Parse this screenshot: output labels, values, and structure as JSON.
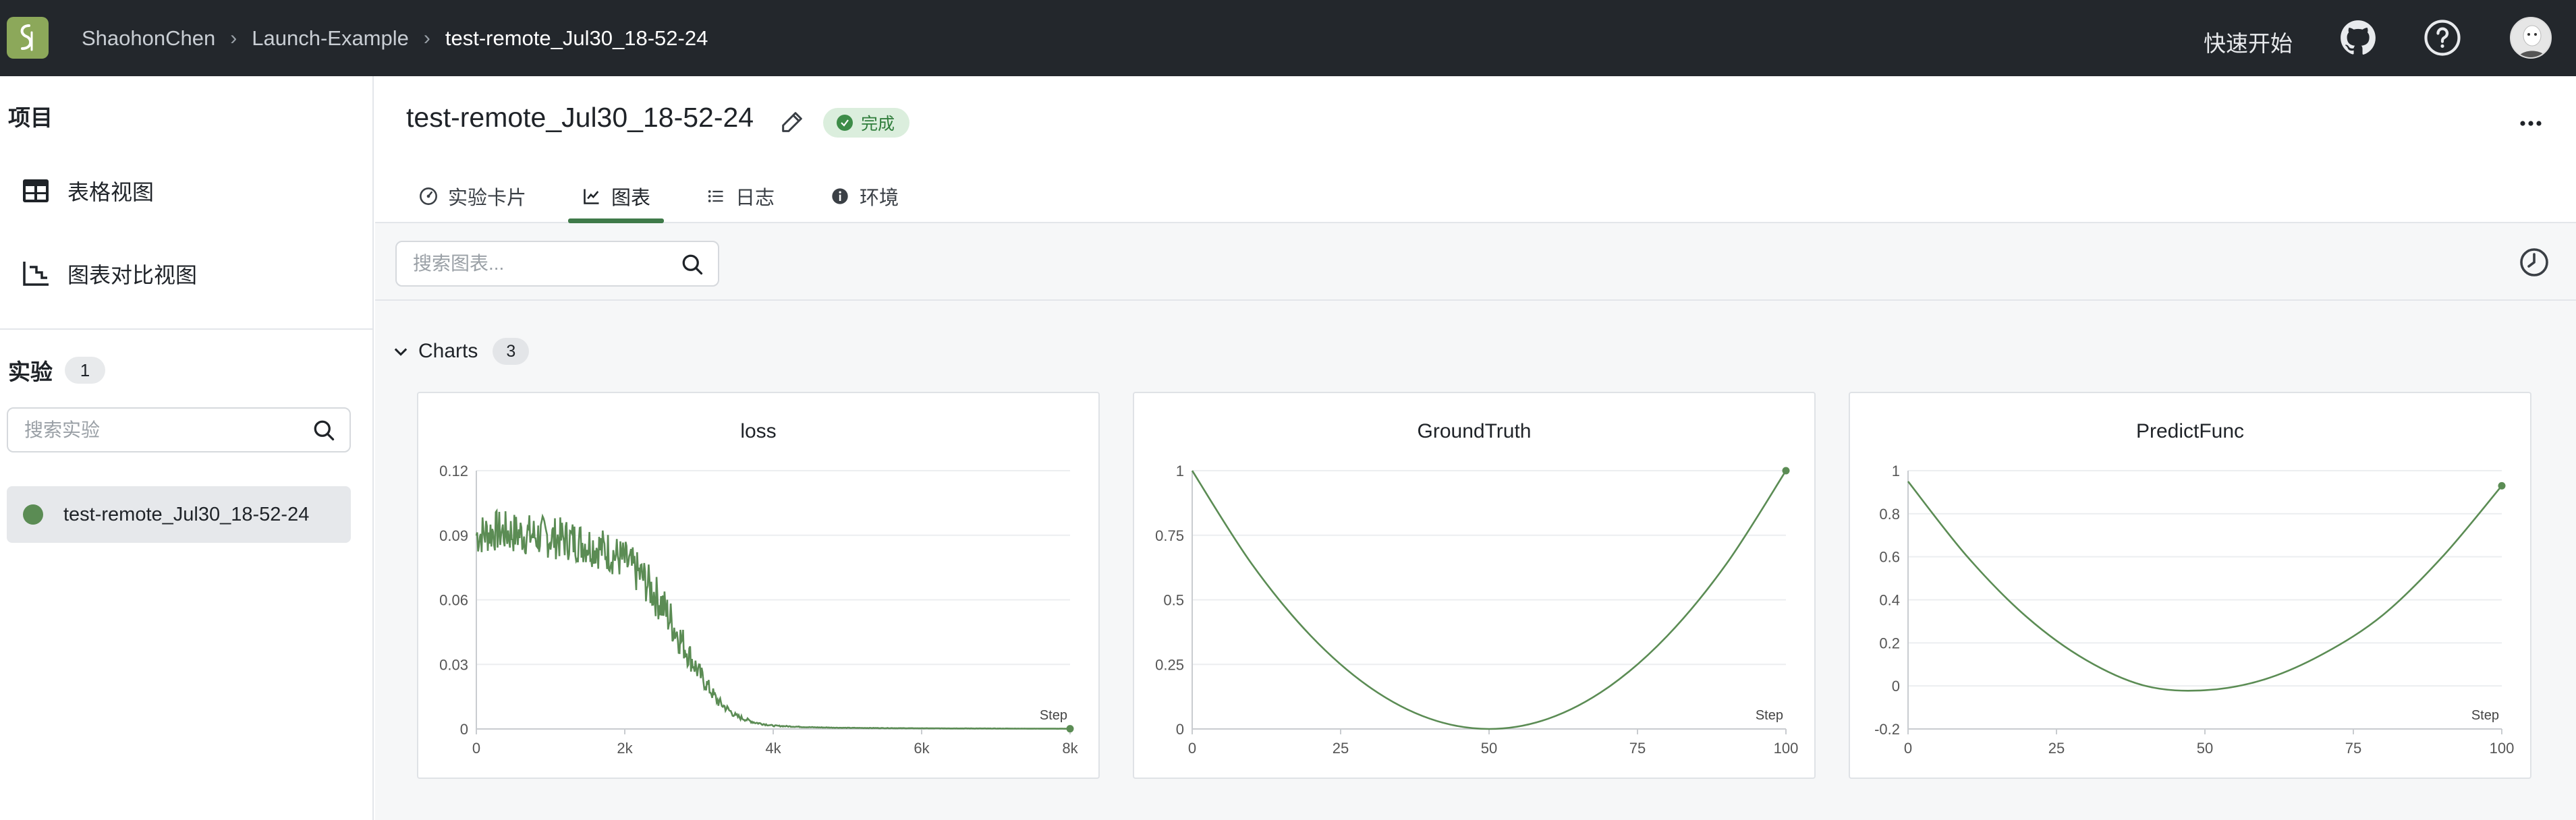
{
  "topbar": {
    "breadcrumbs": [
      "ShaohonChen",
      "Launch-Example",
      "test-remote_Jul30_18-52-24"
    ],
    "quick_start": "快速开始",
    "icons": [
      "github-icon",
      "help-icon",
      "avatar"
    ]
  },
  "sidebar": {
    "project_heading": "项目",
    "nav": [
      {
        "label": "表格视图",
        "icon": "table-icon"
      },
      {
        "label": "图表对比视图",
        "icon": "chart-compare-icon"
      }
    ],
    "experiments_heading": "实验",
    "experiments_count": "1",
    "search_placeholder": "搜索实验",
    "experiments": [
      {
        "name": "test-remote_Jul30_18-52-24",
        "color": "#5b8c54"
      }
    ]
  },
  "header": {
    "title": "test-remote_Jul30_18-52-24",
    "status": "完成",
    "tabs": [
      {
        "label": "实验卡片",
        "icon": "dashboard-icon"
      },
      {
        "label": "图表",
        "icon": "line-chart-icon",
        "active": true
      },
      {
        "label": "日志",
        "icon": "list-icon"
      },
      {
        "label": "环境",
        "icon": "info-icon"
      }
    ]
  },
  "toolbar": {
    "search_placeholder": "搜索图表..."
  },
  "group": {
    "name": "Charts",
    "count": "3"
  },
  "colors": {
    "accent": "#3f7a49",
    "series": "#5b8c54",
    "topbar": "#23272c"
  },
  "chart_data": [
    {
      "type": "line",
      "title": "loss",
      "xlabel": "Step",
      "ylabel": "",
      "xlim": [
        0,
        8000
      ],
      "ylim": [
        0,
        0.12
      ],
      "xticks": [
        "0",
        "2k",
        "4k",
        "6k",
        "8k"
      ],
      "yticks": [
        "0",
        "0.03",
        "0.06",
        "0.09",
        "0.12"
      ],
      "series": [
        {
          "x": [
            0,
            250,
            500,
            750,
            1000,
            1250,
            1500,
            1750,
            2000,
            2250,
            2500,
            2750,
            3000,
            3250,
            3500,
            3750,
            4000,
            4500,
            5000,
            6000,
            7000,
            8000
          ],
          "y": [
            0.09,
            0.092,
            0.091,
            0.09,
            0.089,
            0.088,
            0.086,
            0.083,
            0.078,
            0.07,
            0.058,
            0.042,
            0.026,
            0.013,
            0.006,
            0.003,
            0.0015,
            0.0008,
            0.0005,
            0.0003,
            0.0002,
            0.0001
          ]
        }
      ],
      "grid": true
    },
    {
      "type": "line",
      "title": "GroundTruth",
      "xlabel": "Step",
      "ylabel": "",
      "xlim": [
        0,
        100
      ],
      "ylim": [
        0,
        1
      ],
      "xticks": [
        "0",
        "25",
        "50",
        "75",
        "100"
      ],
      "yticks": [
        "0",
        "0.25",
        "0.5",
        "0.75",
        "1"
      ],
      "series": [
        {
          "x": [
            0,
            10,
            20,
            30,
            40,
            50,
            60,
            70,
            80,
            90,
            100
          ],
          "y": [
            1,
            0.64,
            0.36,
            0.16,
            0.04,
            0,
            0.04,
            0.16,
            0.36,
            0.64,
            1
          ]
        }
      ],
      "grid": true
    },
    {
      "type": "line",
      "title": "PredictFunc",
      "xlabel": "Step",
      "ylabel": "",
      "xlim": [
        0,
        100
      ],
      "ylim": [
        -0.2,
        1
      ],
      "xticks": [
        "0",
        "25",
        "50",
        "75",
        "100"
      ],
      "yticks": [
        "-0.2",
        "0",
        "0.2",
        "0.4",
        "0.6",
        "0.8",
        "1"
      ],
      "series": [
        {
          "x": [
            0,
            10,
            20,
            30,
            40,
            50,
            60,
            70,
            80,
            90,
            100
          ],
          "y": [
            0.95,
            0.6,
            0.32,
            0.12,
            0.0,
            -0.02,
            0.03,
            0.15,
            0.33,
            0.6,
            0.93
          ]
        }
      ],
      "grid": true
    }
  ]
}
